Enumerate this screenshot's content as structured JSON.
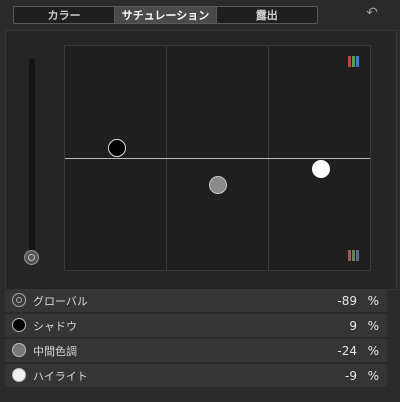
{
  "tabs": [
    {
      "label": "カラー",
      "active": false
    },
    {
      "label": "サチュレーション",
      "active": true
    },
    {
      "label": "露出",
      "active": false
    }
  ],
  "undo_icon": "undo-icon",
  "board": {
    "puck_colors": {
      "shadow": "#000000",
      "midtone": "#8a8a8a",
      "highlight": "#ffffff"
    },
    "rgb_colors": [
      "#d23b3b",
      "#3ab04a",
      "#3e7be0"
    ],
    "gray_colors": [
      "#9c5a5a",
      "#5a8a5a",
      "#5a6a8a"
    ]
  },
  "rows": [
    {
      "label": "グローバル",
      "value": "-89",
      "unit": "%",
      "icon": "global-puck-icon"
    },
    {
      "label": "シャドウ",
      "value": "9",
      "unit": "%",
      "icon": "shadow-puck-icon"
    },
    {
      "label": "中間色調",
      "value": "-24",
      "unit": "%",
      "icon": "midtone-puck-icon"
    },
    {
      "label": "ハイライト",
      "value": "-9",
      "unit": "%",
      "icon": "highlight-puck-icon"
    }
  ]
}
